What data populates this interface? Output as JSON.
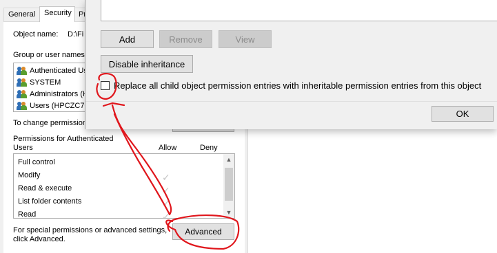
{
  "props": {
    "tabs": [
      "General",
      "Security",
      "Pr"
    ],
    "object_name_label": "Object name:",
    "object_name_value": "D:\\Fi",
    "group_label": "Group or user names:",
    "users": [
      {
        "name": "Authenticated Us"
      },
      {
        "name": "SYSTEM"
      },
      {
        "name": "Administrators (H"
      },
      {
        "name": "Users (HPCZC70"
      }
    ],
    "change_hint": "To change permission",
    "perms_for_line1": "Permissions for Authenticated",
    "perms_for_line2": "Users",
    "allow_header": "Allow",
    "deny_header": "Deny",
    "permissions": [
      {
        "name": "Full control",
        "allow": false
      },
      {
        "name": "Modify",
        "allow": true
      },
      {
        "name": "Read & execute",
        "allow": true
      },
      {
        "name": "List folder contents",
        "allow": true
      },
      {
        "name": "Read",
        "allow": true
      }
    ],
    "special_hint_line1": "For special permissions or advanced settings,",
    "special_hint_line2": "click Advanced.",
    "advanced_button": "Advanced"
  },
  "dialog": {
    "add_button": "Add",
    "remove_button": "Remove",
    "view_button": "View",
    "disable_inheritance_button": "Disable inheritance",
    "replace_checkbox_label": "Replace all child object permission entries with inheritable permission entries from this object",
    "replace_checkbox_checked": false,
    "ok_button": "OK"
  },
  "colors": {
    "annotation": "#e0161c",
    "window_bg": "#f0f0f0",
    "disabled_button": "#cccccc"
  },
  "icons": {
    "user_group": "users-group-icon",
    "check": "checkmark-icon"
  }
}
